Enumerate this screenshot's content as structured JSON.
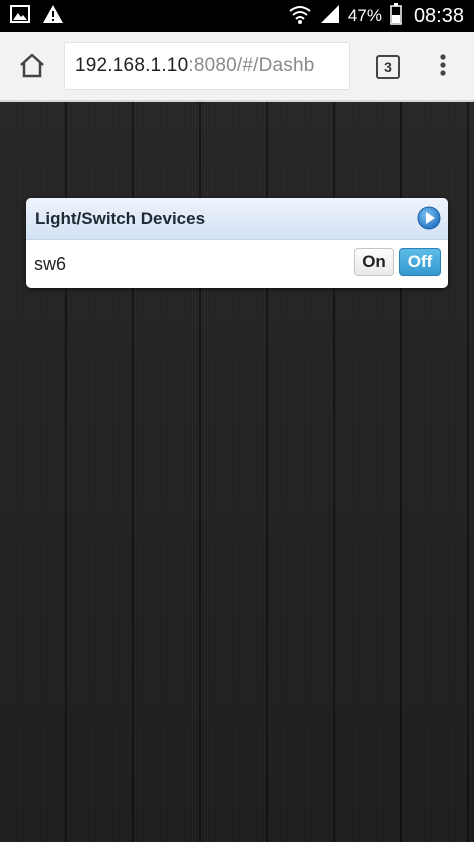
{
  "status_bar": {
    "battery_percent": "47%",
    "time": "08:38",
    "icons": [
      "image-icon",
      "warning-icon",
      "wifi-icon",
      "signal-icon",
      "battery-icon"
    ]
  },
  "browser": {
    "url_host": "192.168.1.10",
    "url_rest": ":8080/#/Dashb",
    "tab_count": "3",
    "icons": [
      "home-icon",
      "tabs-icon",
      "overflow-menu-icon"
    ]
  },
  "panel": {
    "title": "Light/Switch Devices",
    "devices": [
      {
        "name": "sw6",
        "on_label": "On",
        "off_label": "Off",
        "state": "off"
      }
    ]
  },
  "colors": {
    "accent_blue": "#3598d0",
    "panel_header": "#d3e2f5",
    "background": "#232323"
  }
}
